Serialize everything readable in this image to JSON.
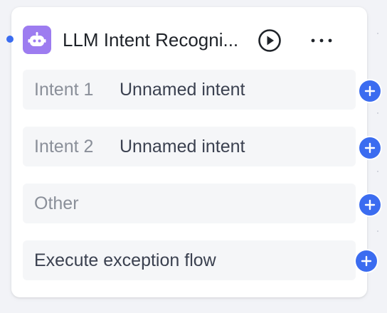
{
  "node": {
    "title": "LLM Intent Recogni...",
    "icon": "robot-icon",
    "accent_color": "#9d7cf0",
    "handle_color": "#3b6cf0"
  },
  "rows": [
    {
      "label": "Intent 1",
      "value": "Unnamed intent"
    },
    {
      "label": "Intent 2",
      "value": "Unnamed intent"
    },
    {
      "label": "Other",
      "value": ""
    },
    {
      "label": "Execute exception flow",
      "value": ""
    }
  ],
  "icons": {
    "run": "play-circle-icon",
    "more": "more-horizontal-icon",
    "add": "plus-icon"
  }
}
